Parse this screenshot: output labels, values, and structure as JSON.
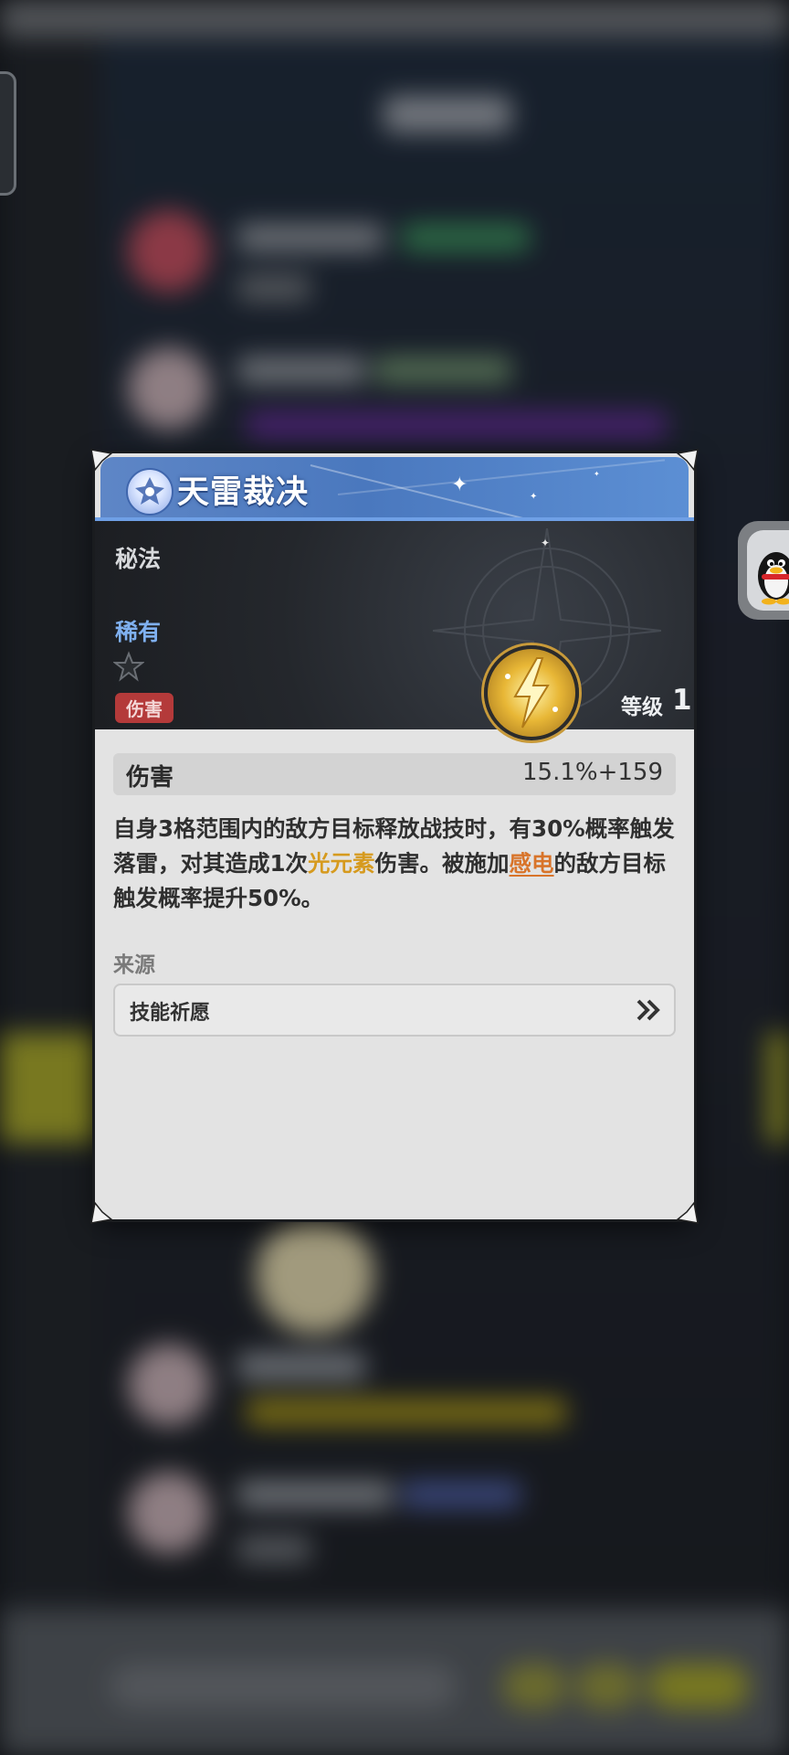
{
  "card": {
    "title": "天雷裁决",
    "category": "秘法",
    "rarity": "稀有",
    "tag": "伤害",
    "level_label": "等级",
    "level_value": "1",
    "stat": {
      "name": "伤害",
      "value": "15.1%+159"
    },
    "description": {
      "part1": "自身3格范围内的敌方目标释放战技时，有30%概率触发落雷，对其造成1次",
      "highlight_element": "光元素",
      "part2": "伤害。被施加",
      "highlight_status": "感电",
      "part3": "的敌方目标触发概率提升50%。"
    },
    "source_label": "来源",
    "source_button": "技能祈愿"
  },
  "colors": {
    "header_blue": "#4a78be",
    "rarity_blue": "#7fb0f0",
    "damage_tag_red": "#b43a3a",
    "highlight_light": "#d69a1e",
    "highlight_electro": "#d8742a"
  },
  "icons": [
    "emblem-icon",
    "skill-icon",
    "star-icon",
    "double-chevron-icon",
    "qq-penguin-icon",
    "corner-ornament-icon"
  ]
}
